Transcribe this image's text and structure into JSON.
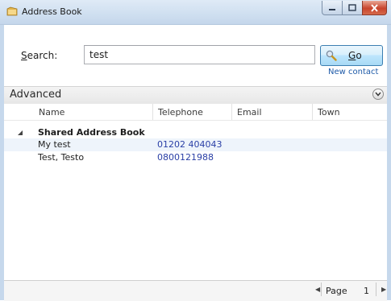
{
  "window": {
    "title": "Address Book",
    "icon": "address-book-icon"
  },
  "search": {
    "label_prefix": "S",
    "label_rest": "earch:",
    "value": "test",
    "go_label_prefix": "G",
    "go_label_rest": "o",
    "new_contact": "New contact"
  },
  "advanced": {
    "label": "Advanced"
  },
  "columns": [
    "Name",
    "Telephone",
    "Email",
    "Town"
  ],
  "group": {
    "label": "Shared Address Book"
  },
  "rows": [
    {
      "name": "My test",
      "telephone": "01202 404043",
      "email": "",
      "town": ""
    },
    {
      "name": "Test, Testo",
      "telephone": "0800121988",
      "email": "",
      "town": ""
    }
  ],
  "pager": {
    "page_label": "Page",
    "page_number": "1"
  },
  "colors": {
    "phone_link": "#2a3fa6",
    "selected_row": "#eef4fb",
    "accent": "#1e5aa8"
  }
}
